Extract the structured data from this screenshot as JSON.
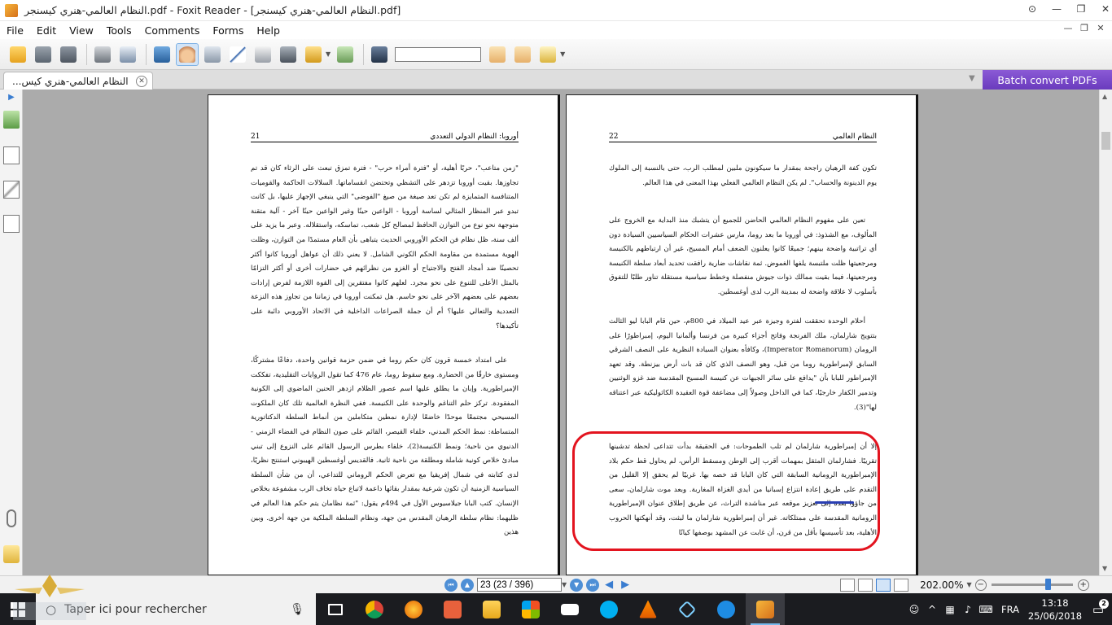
{
  "window": {
    "title": "النظام العالمي-هنري كيسنجر.pdf - Foxit Reader - [النظام العالمي-هنري كيسنجر.pdf]",
    "controls": {
      "minimize": "—",
      "maximize": "❐",
      "close": "✕"
    },
    "mdi": {
      "minimize": "—",
      "restore": "❐",
      "close": "✕"
    }
  },
  "menu": [
    "File",
    "Edit",
    "View",
    "Tools",
    "Comments",
    "Forms",
    "Help"
  ],
  "toolbar": {
    "find_value": "",
    "icons": [
      "open-icon",
      "save-icon",
      "save-all-icon",
      "print-icon",
      "properties-icon",
      "fullscreen-icon",
      "hand-icon",
      "snapshot-icon",
      "select-icon",
      "typewriter-icon",
      "camera-icon",
      "rms-icon",
      "tools-icon",
      "find-icon",
      "prev-find-icon",
      "next-find-icon",
      "comment-icon"
    ]
  },
  "tabs": [
    {
      "label": "...النظام العالمي-هنري كيس"
    }
  ],
  "batch_label": "Batch convert PDFs",
  "left_page": {
    "header_title": "أوروبا: النظام الدولي التعددي",
    "page_number": "21",
    "paragraphs": [
      "\"زمن متاعب\"، حربًا أهلية، أو \"فترة أمراء حرب\" - فترة تمزق تبعث على الرثاء كان قد تم تجاوزها. بقيت أوروبا تزدهر على التشظي وتحتضن انقساماتها. السلالات الحاكمة والقوميات المتنافسة المتمايزة لم تكن تعد صيغة من صيغ \"الفوضى\" التي ينبغي الإجهاز عليها، بل كانت تبدو عبر المنظار المثالي لساسة أوروبا - الواعين حينًا وغير الواعين حينًا آخر - آلية متقنة متوجهة نحو نوع من التوازن الحافظ لمصالح كل شعب، تماسكه، واستقلاله. وعبر ما يزيد على ألف سنة، ظل نظام فن الحكم الأوروبي الحديث يتباهى بأن العام مستمدًا من التوازن، وظلت الهوية مستمدة من مقاومة الحكم الكوني الشامل. لا يعني ذلك أن عواهل أوروبا كانوا أكثر تحصينًا ضد أمجاد الفتح والاجتياح أو الغزو من نظرائهم في حضارات أخرى أو أكثر التزامًا بالمثل الأعلى للتنوع على نحو مجرد. لعلهم كانوا مفتقرين إلى القوة اللازمة لفرض إرادات بعضهم على بعضهم الآخر على نحو حاسم. هل تمكنت أوروبا في زماننا من تجاوز هذه النزعة التعددية والتعالي عليها؟ أم أن جملة الصراعات الداخلية في الاتحاد الأوروبي دائبة على تأكيدها؟",
      "على امتداد خمسة قرون كان حكم روما في ضمن حزمة قوانين واحدة، دفاعًا مشتركًا، ومستوى خارقًا من الحضارة. ومع سقوط روما، عام 476 كما تقول الروايات التقليدية، تفككت الإمبراطورية. وإبان ما يطلق عليها اسم عصور الظلام ازدهر الحنين الماضوي إلى الكونية المفقودة. تركز حلم التناغم والوحدة على الكنيسة. ففي النظرة العالمية تلك كان الملكوت المسيحي مجتمعًا موحدًا خاضعًا لإدارة نمطين متكاملين من أنماط السلطة الدكتاتورية المتساطة: نمط الحكم المدني، خلفاء القيصر، القائم على صون النظام في الفضاء الزمني - الدنيوي من ناحية؛ ونمط الكنيسة(2)، خلفاء بطرس الرسول القائم على النزوع إلى تبني مبادئ خلاص كونية شاملة ومطلقة من ناحية ثانية. فالقديس أوغسطين الهيبوني استنتج نظريًا، لدى كتابته في شمال إفريقيا مع تعرض الحكم الروماني للتداعي، أن من شأن السلطة السياسية الزمنية أن تكون شرعية بمقدار بقائها داعمة لاتباع حياة تخاف الرب مشفوعة بخلاص الإنسان. كتب البابا جيلاسيوس الأول في 494م يقول: \"ثمة نظامان يتم حكم هذا العالم في ظليهما: نظام سلطة الرهبان المقدس من جهة، ونظام السلطة الملكية من جهة أخرى. وبين هذين"
    ]
  },
  "right_page": {
    "header_title": "النظام العالمي",
    "page_number": "22",
    "paragraphs": [
      "تكون كفة الرهبان راجحة بمقدار ما سيكونون ملبين لمطلب الرب، حتى بالنسبة إلى الملوك يوم الدينونة والحساب\". لم يكن النظام العالمي الفعلي بهذا المعنى في هذا العالم.",
      "تعين على مفهوم النظام العالمي الحاضن للجميع أن يتشبك منذ البداية مع الخروج على المألوف، مع الشذوذ: في أوروبا ما بعد روما، مارس عشرات الحكام السياسيين السيادة دون أي تراتبية واضحة بينهم؛ جميعًا كانوا يعلنون الضعف أمام المسيح، غير أن ارتباطهم بالكنيسة ومرجعيتها ظلت ملتبسة يلفها الغموض. ثمة نقاشات ضارية رافقت تحديد أبعاد سلطة الكنيسة ومرجعيتها، فيما بقيت ممالك ذوات جيوش منفصلة وخطط سياسية مستقلة تناور طلبًا للتفوق بأسلوب لا علاقة واضحة له بمدينة الرب لدى أوغسطين.",
      "أحلام الوحدة تحققت لفترة وجيزة عبر عيد الميلاد في 800م، حين قام البابا ليو الثالث بتتويج شارلمان، ملك الفرنجة وفاتح أجزاء كبيرة من فرنسا وألمانيا اليوم، إمبراطورًا على الرومان (Imperator Romanorum)، وكافأه بعنوان السيادة النظرية على النصف الشرقي السابق لإمبراطورية روما من قبل، وهو النصف الذي كان قد بات أرض بيزنطة. وقد تعهد الإمبراطور للبابا بأن \"يدافع على سائر الجبهات عن كنيسة المسيح المقدسة ضد غزو الوثنيين وتدمير الكفار خارجيًا، كما في الداخل وصولاً إلى مضاعفة قوة العقيدة الكاثوليكية عبر اعتناقه لها\"(3).",
      "إلا أن إمبراطورية شارلمان لم تلب الطموحات: في الحقيقة بدأت تتداعى لحظة تدشينها تقريبًا. فشارلمان المثقل بمهمات أقرب إلى الوطن ومسقط الرأس، لم يحاول قط حكم بلاد الإمبراطورية الرومانية السابقة التي كان البابا قد خصه بها. غربيًا لم يحقق إلا القليل من التقدم على طريق إعادة انتزاع إسبانيا من أيدي الغزاة المغاربة. وبعد موت شارلمان، سعى من جاؤوا بعده إلى تعزيز موقعه عبر مناشدة التراث، عن طريق إطلاق عنوان الإمبراطورية الرومانية المقدسة على ممتلكاته. غير أن إمبراطورية شارلمان ما لبثت، وقد أنهكتها الحروب الأهلية، بعد تأسيسها بأقل من قرن، أن غابت عن المشهد بوصفها كيانًا"
    ]
  },
  "status": {
    "page_field": "23 (23 / 396)",
    "zoom": "202.00%"
  },
  "taskbar": {
    "search_placeholder": "Taper ici pour rechercher",
    "lang": "FRA",
    "time": "13:18",
    "date": "25/06/2018",
    "notifications": "2"
  },
  "colors": {
    "annotation_oval": "#e3141f",
    "underline": "#2a3fb2",
    "batch_bg": "#7a47c9",
    "taskbar": "#1b1c20"
  }
}
